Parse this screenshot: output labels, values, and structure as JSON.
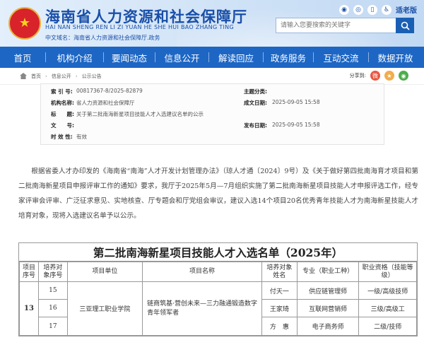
{
  "header": {
    "title": "海南省人力资源和社会保障厅",
    "pinyin": "HAI NAN SHENG REN LI ZI YUAN HE SHE HUI BAO ZHANG TING",
    "domain": "中文域名：海南省人力资源和社会保障厅.政务",
    "care_mode": "适老版",
    "search_placeholder": "请输入您要搜索的关键字"
  },
  "nav": [
    "首页",
    "机构介绍",
    "要闻动态",
    "信息公开",
    "解读回应",
    "政务服务",
    "互动交流",
    "数据开放"
  ],
  "breadcrumb": [
    "首页",
    "信息公开",
    "公示公告"
  ],
  "share_label": "分享到:",
  "info": {
    "index_label": "索 引 号:",
    "index_value": "00817367-8/2025-82879",
    "org_label": "机构名称:",
    "org_value": "省人力资源和社会保障厅",
    "title_label": "标　　题:",
    "title_value": "关于第二批南海新星项目技能人才入选建议名单的公示",
    "doc_label": "文　　号:",
    "doc_value": "",
    "valid_label": "时 效 性:",
    "valid_value": "有效",
    "topic_label": "主题分类:",
    "topic_value": "",
    "date_label": "成文日期:",
    "date_value": "2025-09-05 15:58",
    "pub_label": "发布日期:",
    "pub_value": "2025-09-05 15:58"
  },
  "paragraph": "根据省委人才办印发的《海南省“南海”人才开发计划管理办法》（琼人才通〔2024〕9号）及《关于做好第四批南海育才项目和第二批南海新星项目申报评审工作的通知》要求，我厅于2025年5月—7月组织实施了第二批南海新星项目技能人才申报评选工作，经专家评审会评审、广泛征求意见、实地核查、厅专题会和厅党组会审议，建议入选14个项目20名优秀青年技能人才为南海新星技能人才培育对象，现将入选建议名单予以公示。",
  "table": {
    "title": "第二批南海新星项目技能人才入选名单（2025年）",
    "headers": [
      "项目序号",
      "培养对象序号",
      "项目单位",
      "项目名称",
      "培养对象姓名",
      "专业（职业工种）",
      "职业资格（技能等级）"
    ],
    "project_no": "13",
    "unit": "三亚理工职业学院",
    "project_name": "链商筑基·营创未来—三力融通锻造数字青年领军者",
    "rows": [
      {
        "no": "15",
        "name": "付天一",
        "major": "供应链管理师",
        "level": "一级/高级技师"
      },
      {
        "no": "16",
        "name": "王家琦",
        "major": "互联网营销师",
        "level": "三级/高级工"
      },
      {
        "no": "17",
        "name": "方　惠",
        "major": "电子商务师",
        "level": "二级/技师"
      }
    ]
  }
}
